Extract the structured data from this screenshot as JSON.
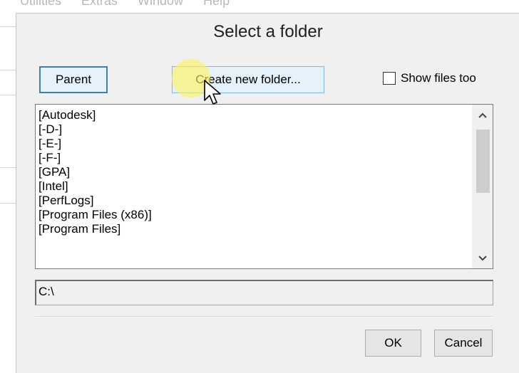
{
  "background_app": {
    "menu": [
      "Utilities",
      "Extras",
      "Window",
      "Help"
    ]
  },
  "dialog": {
    "title": "Select a folder",
    "parent_label": "Parent",
    "create_label": "Create new folder...",
    "show_files_label": "Show files too",
    "show_files_checked": false,
    "folders": [
      "[Autodesk]",
      "[-D-]",
      "[-E-]",
      "[-F-]",
      "[GPA]",
      "[Intel]",
      "[PerfLogs]",
      "[Program Files (x86)]",
      "[Program Files]"
    ],
    "path_value": "C:\\",
    "ok_label": "OK",
    "cancel_label": "Cancel"
  },
  "icons": {
    "scroll_up": "chevron-up-icon",
    "scroll_down": "chevron-down-icon",
    "cursor": "mouse-pointer-icon"
  }
}
